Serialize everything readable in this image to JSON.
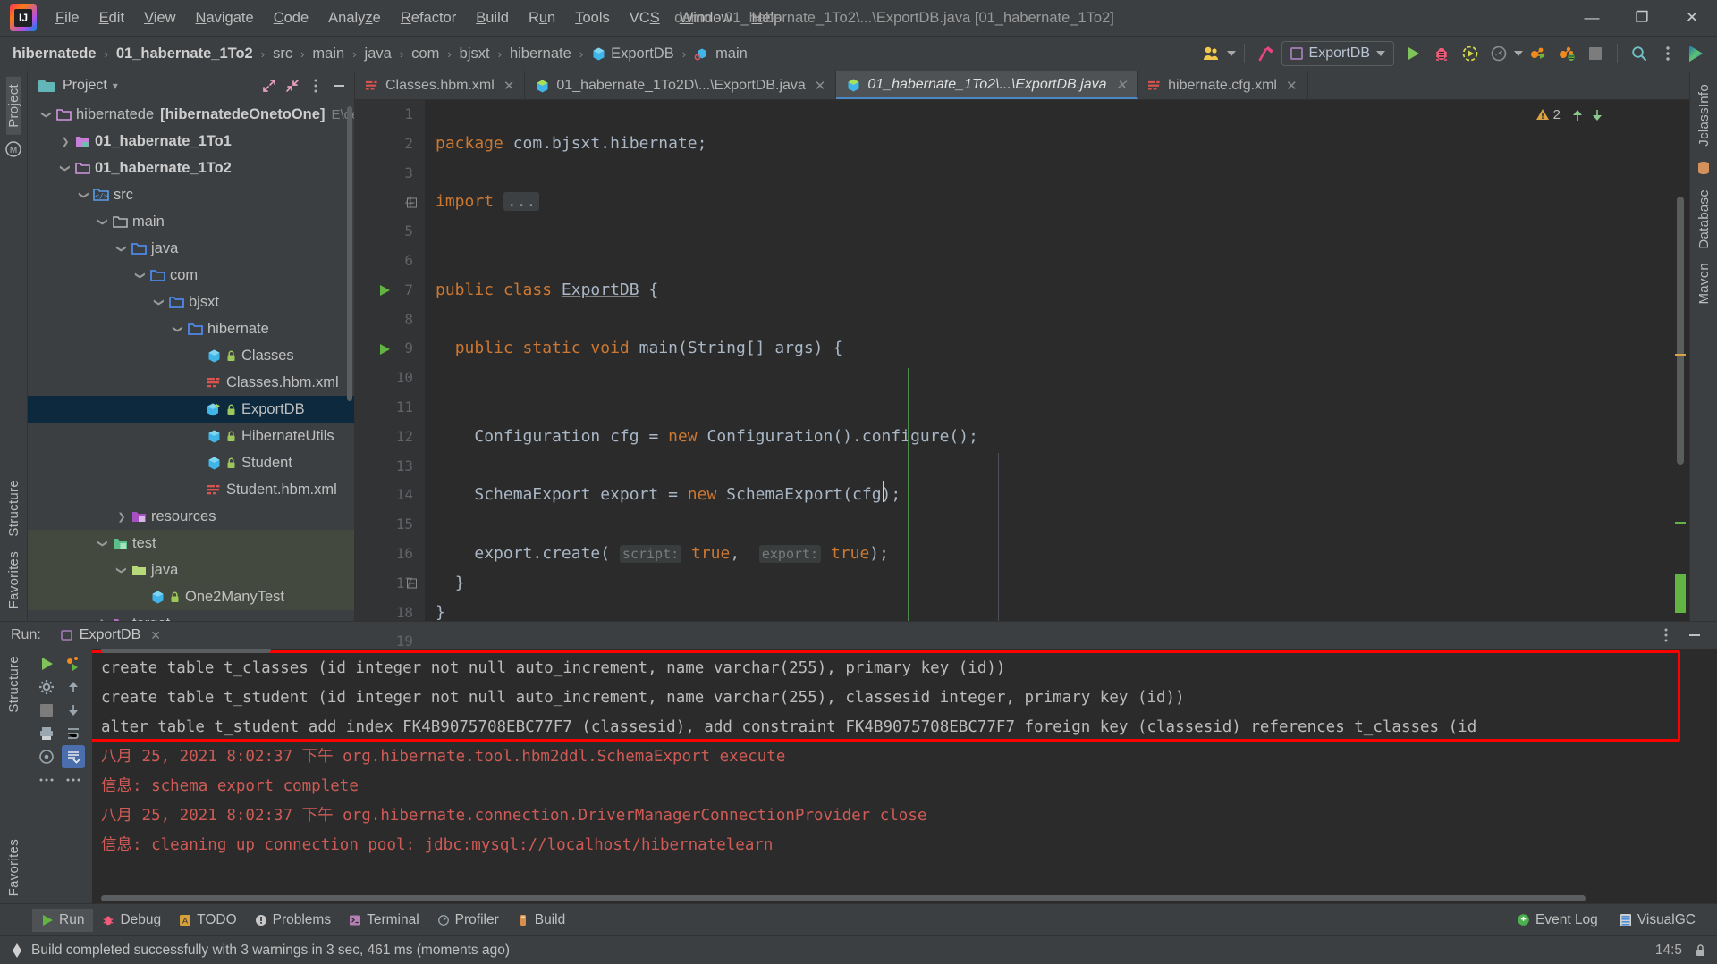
{
  "window": {
    "title": "demo - 01_habernate_1To2\\...\\ExportDB.java [01_habernate_1To2]",
    "minimize": "—",
    "maximize": "❐",
    "close": "✕"
  },
  "menubar": {
    "items": [
      {
        "label": "File",
        "mnemonic": "F"
      },
      {
        "label": "Edit",
        "mnemonic": "E"
      },
      {
        "label": "View",
        "mnemonic": "V"
      },
      {
        "label": "Navigate",
        "mnemonic": "N"
      },
      {
        "label": "Code",
        "mnemonic": "C"
      },
      {
        "label": "Analyze",
        "mnemonic": "z"
      },
      {
        "label": "Refactor",
        "mnemonic": "R"
      },
      {
        "label": "Build",
        "mnemonic": "B"
      },
      {
        "label": "Run",
        "mnemonic": "u"
      },
      {
        "label": "Tools",
        "mnemonic": "T"
      },
      {
        "label": "VCS",
        "mnemonic": "S"
      },
      {
        "label": "Window",
        "mnemonic": "W"
      },
      {
        "label": "Help",
        "mnemonic": "H"
      }
    ]
  },
  "breadcrumb": {
    "items": [
      {
        "label": "hibernatede",
        "bold": true,
        "icon": ""
      },
      {
        "label": "01_habernate_1To2",
        "bold": true,
        "icon": ""
      },
      {
        "label": "src",
        "bold": false,
        "icon": ""
      },
      {
        "label": "main",
        "bold": false,
        "icon": ""
      },
      {
        "label": "java",
        "bold": false,
        "icon": ""
      },
      {
        "label": "com",
        "bold": false,
        "icon": ""
      },
      {
        "label": "bjsxt",
        "bold": false,
        "icon": ""
      },
      {
        "label": "hibernate",
        "bold": false,
        "icon": ""
      },
      {
        "label": "ExportDB",
        "bold": false,
        "icon": "class-icon"
      },
      {
        "label": "main",
        "bold": false,
        "icon": "method-icon"
      }
    ],
    "separator": "›"
  },
  "toolbar": {
    "run_config": "ExportDB",
    "icons": [
      "users-icon",
      "hammer-icon",
      "run-icon",
      "debug-icon",
      "run-with-coverage-icon",
      "profiler-icon",
      "attach-profiler-icon",
      "attach-debugger-icon",
      "stop-icon",
      "search-everywhere-icon",
      "more-icon",
      "visualgc-icon"
    ]
  },
  "left_rail": {
    "top_label": "Project",
    "maven_label": "M",
    "bottom_labels": [
      "Structure",
      "Favorites"
    ]
  },
  "right_rail": {
    "labels": [
      "JclassInfo",
      "Database",
      "Maven"
    ]
  },
  "project_panel": {
    "title": "Project",
    "expand_icon": "expand-all-icon",
    "collapse_icon": "collapse-all-icon",
    "options_icon": "options-icon",
    "hide_icon": "hide-icon",
    "tree": [
      {
        "label": "hibernatede",
        "sub": "[hibernatedeOnetoOne]",
        "path": "E\\dev",
        "indent": 0,
        "twisty": "down",
        "icon": "folder-module",
        "bold": false
      },
      {
        "label": "01_habernate_1To1",
        "sub": "",
        "path": "",
        "indent": 1,
        "twisty": "right",
        "icon": "folder-module-src",
        "bold": true
      },
      {
        "label": "01_habernate_1To2",
        "sub": "",
        "path": "",
        "indent": 1,
        "twisty": "down",
        "icon": "folder-module",
        "bold": true
      },
      {
        "label": "src",
        "sub": "",
        "path": "",
        "indent": 2,
        "twisty": "down",
        "icon": "folder-src",
        "bold": false
      },
      {
        "label": "main",
        "sub": "",
        "path": "",
        "indent": 3,
        "twisty": "down",
        "icon": "folder-plain",
        "bold": false
      },
      {
        "label": "java",
        "sub": "",
        "path": "",
        "indent": 4,
        "twisty": "down",
        "icon": "folder-source",
        "bold": false
      },
      {
        "label": "com",
        "sub": "",
        "path": "",
        "indent": 5,
        "twisty": "down",
        "icon": "folder-source",
        "bold": false
      },
      {
        "label": "bjsxt",
        "sub": "",
        "path": "",
        "indent": 6,
        "twisty": "down",
        "icon": "folder-source",
        "bold": false
      },
      {
        "label": "hibernate",
        "sub": "",
        "path": "",
        "indent": 7,
        "twisty": "down",
        "icon": "folder-source",
        "bold": false
      },
      {
        "label": "Classes",
        "sub": "",
        "path": "",
        "indent": 8,
        "twisty": "",
        "icon": "java-class",
        "bold": false
      },
      {
        "label": "Classes.hbm.xml",
        "sub": "",
        "path": "",
        "indent": 8,
        "twisty": "",
        "icon": "xml-file",
        "bold": false
      },
      {
        "label": "ExportDB",
        "sub": "",
        "path": "",
        "indent": 8,
        "twisty": "",
        "icon": "java-class-run",
        "bold": false
      },
      {
        "label": "HibernateUtils",
        "sub": "",
        "path": "",
        "indent": 8,
        "twisty": "",
        "icon": "java-class",
        "bold": false
      },
      {
        "label": "Student",
        "sub": "",
        "path": "",
        "indent": 8,
        "twisty": "",
        "icon": "java-class",
        "bold": false
      },
      {
        "label": "Student.hbm.xml",
        "sub": "",
        "path": "",
        "indent": 8,
        "twisty": "",
        "icon": "xml-file",
        "bold": false
      },
      {
        "label": "resources",
        "sub": "",
        "path": "",
        "indent": 4,
        "twisty": "right",
        "icon": "folder-resources",
        "bold": false
      },
      {
        "label": "test",
        "sub": "",
        "path": "",
        "indent": 3,
        "twisty": "down",
        "icon": "folder-test",
        "bold": false
      },
      {
        "label": "java",
        "sub": "",
        "path": "",
        "indent": 4,
        "twisty": "down",
        "icon": "folder-test-source",
        "bold": false
      },
      {
        "label": "One2ManyTest",
        "sub": "",
        "path": "",
        "indent": 5,
        "twisty": "",
        "icon": "java-class",
        "bold": false
      },
      {
        "label": "target",
        "sub": "",
        "path": "",
        "indent": 3,
        "twisty": "right",
        "icon": "folder-excluded",
        "bold": false
      }
    ],
    "selected_index": 11,
    "test_rows": [
      16,
      17,
      18
    ]
  },
  "editor": {
    "tabs": [
      {
        "label": "Classes.hbm.xml",
        "icon": "xml-file",
        "active": false
      },
      {
        "label": "01_habernate_1To2D\\...\\ExportDB.java",
        "icon": "java-file",
        "active": false
      },
      {
        "label": "01_habernate_1To2\\...\\ExportDB.java",
        "icon": "java-file",
        "active": true
      },
      {
        "label": "hibernate.cfg.xml",
        "icon": "xml-file",
        "active": false
      }
    ],
    "close_glyph": "✕",
    "warning_count": "2",
    "lines": [
      {
        "n": "1",
        "html": ""
      },
      {
        "n": "2",
        "html": "<span class='kw'>package</span> <span class='pl'>com.bjsxt.hibernate;</span>"
      },
      {
        "n": "3",
        "html": ""
      },
      {
        "n": "4",
        "html": "<span class='kw'>import</span> <span class='fold-dots'>...</span>",
        "fold": true
      },
      {
        "n": "5",
        "html": ""
      },
      {
        "n": "6",
        "html": ""
      },
      {
        "n": "7",
        "html": "<span class='kw'>public class</span> <span class='clsu'>ExportDB</span> <span class='pl'>{</span>",
        "run": true
      },
      {
        "n": "8",
        "html": ""
      },
      {
        "n": "9",
        "html": "  <span class='kw'>public static void</span> <span class='pl'>main(</span><span class='cls'>String</span><span class='pl'>[] args) {</span>",
        "run": true
      },
      {
        "n": "10",
        "html": ""
      },
      {
        "n": "11",
        "html": ""
      },
      {
        "n": "12",
        "html": "    <span class='cls'>Configuration</span> <span class='pl'>cfg = </span><span class='kw'>new</span> <span class='cls'>Configuration</span><span class='pl'>().configure();</span>"
      },
      {
        "n": "13",
        "html": ""
      },
      {
        "n": "14",
        "html": "    <span class='cls'>SchemaExport</span> <span class='pl'>export = </span><span class='kw'>new</span> <span class='cls'>SchemaExport</span><span class='pl'>(cfg);</span>"
      },
      {
        "n": "15",
        "html": ""
      },
      {
        "n": "16",
        "html": "    <span class='pl'>export.create(</span> <span class='hint'>script:</span> <span class='kw'>true</span><span class='pl'>,</span>  <span class='hint'>export:</span> <span class='kw'>true</span><span class='pl'>);</span>"
      },
      {
        "n": "17",
        "html": "  <span class='pl'>}</span>",
        "fold": true
      },
      {
        "n": "18",
        "html": "<span class='pl'>}</span>"
      },
      {
        "n": "19",
        "html": ""
      }
    ]
  },
  "run_window": {
    "label": "Run:",
    "tab": "ExportDB",
    "tab_close": "✕",
    "options_icon": "options-icon",
    "hide_icon": "hide-icon",
    "side_buttons": [
      "rerun-icon",
      "rerun-failed-icon",
      "up-icon",
      "down-icon",
      "stop-icon",
      "print-icon",
      "soft-wrap-icon",
      "scroll-to-end-icon",
      "more-icon"
    ],
    "console": [
      {
        "text": "create table t_classes (id integer not null auto_increment, name varchar(255), primary key (id))",
        "type": "out"
      },
      {
        "text": "create table t_student (id integer not null auto_increment, name varchar(255), classesid integer, primary key (id))",
        "type": "out"
      },
      {
        "text": "alter table t_student add index FK4B9075708EBC77F7 (classesid), add constraint FK4B9075708EBC77F7 foreign key (classesid) references t_classes (id",
        "type": "out"
      },
      {
        "text": "八月 25, 2021 8:02:37 下午 org.hibernate.tool.hbm2ddl.SchemaExport execute",
        "type": "err"
      },
      {
        "text": "信息: schema export complete",
        "type": "err"
      },
      {
        "text": "八月 25, 2021 8:02:37 下午 org.hibernate.connection.DriverManagerConnectionProvider close",
        "type": "err"
      },
      {
        "text": "信息: cleaning up connection pool: jdbc:mysql://localhost/hibernatelearn",
        "type": "err"
      }
    ],
    "highlight_color": "#ff0000"
  },
  "bottom_bar": {
    "buttons": [
      {
        "label": "Run",
        "icon": "run-icon",
        "active": true
      },
      {
        "label": "Debug",
        "icon": "debug-icon",
        "active": false
      },
      {
        "label": "TODO",
        "icon": "todo-icon",
        "active": false
      },
      {
        "label": "Problems",
        "icon": "problems-icon",
        "active": false
      },
      {
        "label": "Terminal",
        "icon": "terminal-icon",
        "active": false
      },
      {
        "label": "Profiler",
        "icon": "profiler-icon",
        "active": false
      },
      {
        "label": "Build",
        "icon": "build-icon",
        "active": false
      }
    ],
    "right_buttons": [
      {
        "label": "Event Log",
        "icon": "event-log-icon"
      },
      {
        "label": "VisualGC",
        "icon": "visualgc-icon"
      }
    ]
  },
  "status_bar": {
    "message": "Build completed successfully with 3 warnings in 3 sec, 461 ms (moments ago)",
    "time": "14:5",
    "lock_icon": "lock-icon",
    "status_icon": "event-icon"
  }
}
